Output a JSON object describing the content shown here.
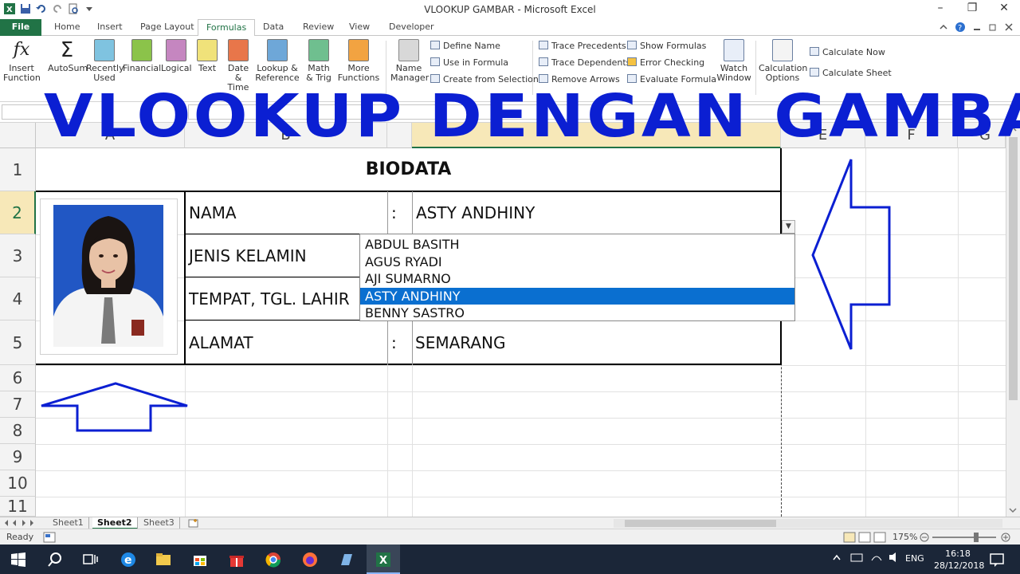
{
  "window": {
    "title": "VLOOKUP GAMBAR  -  Microsoft Excel",
    "minimize": "–",
    "restore": "❐",
    "close": "✕"
  },
  "tabs": {
    "file": "File",
    "home": "Home",
    "insert": "Insert",
    "page_layout": "Page Layout",
    "formulas": "Formulas",
    "data": "Data",
    "review": "Review",
    "view": "View",
    "developer": "Developer"
  },
  "ribbon": {
    "insert_function": [
      "Insert",
      "Function"
    ],
    "fx": "fx",
    "autosum": [
      "AutoSum"
    ],
    "sigma": "Σ",
    "recently_used": [
      "Recently",
      "Used"
    ],
    "financial": [
      "Financial"
    ],
    "logical": [
      "Logical"
    ],
    "text": [
      "Text"
    ],
    "date_time": [
      "Date &",
      "Time"
    ],
    "lookup_ref": [
      "Lookup &",
      "Reference"
    ],
    "math_trig": [
      "Math",
      "& Trig"
    ],
    "more_functions": [
      "More",
      "Functions"
    ],
    "name_manager": [
      "Name",
      "Manager"
    ],
    "define_name": "Define Name",
    "use_in_formula": "Use in Formula",
    "create_from_selection": "Create from Selection",
    "trace_precedents": "Trace Precedents",
    "trace_dependents": "Trace Dependents",
    "remove_arrows": "Remove Arrows",
    "show_formulas": "Show Formulas",
    "error_checking": "Error Checking",
    "evaluate_formula": "Evaluate Formula",
    "watch_window": [
      "Watch",
      "Window"
    ],
    "calculation_options": [
      "Calculation",
      "Options"
    ],
    "calculate_now": "Calculate Now",
    "calculate_sheet": "Calculate Sheet"
  },
  "headline": "VLOOKUP DENGAN GAMBAR",
  "columns": [
    "A",
    "B",
    "",
    "",
    "E",
    "F",
    "G"
  ],
  "rows": [
    "1",
    "2",
    "3",
    "4",
    "5",
    "6",
    "7",
    "8",
    "9",
    "10",
    "11"
  ],
  "sheet": {
    "title": "BIODATA",
    "fields": [
      {
        "label": "NAMA",
        "sep": ":",
        "value": "ASTY ANDHINY"
      },
      {
        "label": "JENIS KELAMIN",
        "sep": "",
        "value": ""
      },
      {
        "label": "TEMPAT, TGL. LAHIR",
        "sep": "",
        "value": ""
      },
      {
        "label": "ALAMAT",
        "sep": ":",
        "value": "SEMARANG"
      }
    ]
  },
  "dropdown": {
    "options": [
      "ABDUL BASITH",
      "AGUS RYADI",
      "AJI SUMARNO",
      "ASTY ANDHINY",
      "BENNY SASTRO"
    ],
    "selected": "ASTY ANDHINY",
    "arrow": "▼"
  },
  "sheet_tabs": [
    "Sheet1",
    "Sheet2",
    "Sheet3"
  ],
  "active_sheet": "Sheet2",
  "status": {
    "ready": "Ready",
    "zoom": "175%"
  },
  "taskbar": {
    "language": "ENG",
    "time": "16:18",
    "date": "28/12/2018"
  },
  "colors": {
    "excel_green": "#217346",
    "headline_blue": "#0b1fd2",
    "selection_blue": "#0a6fd0",
    "taskbar": "#1b2638"
  }
}
